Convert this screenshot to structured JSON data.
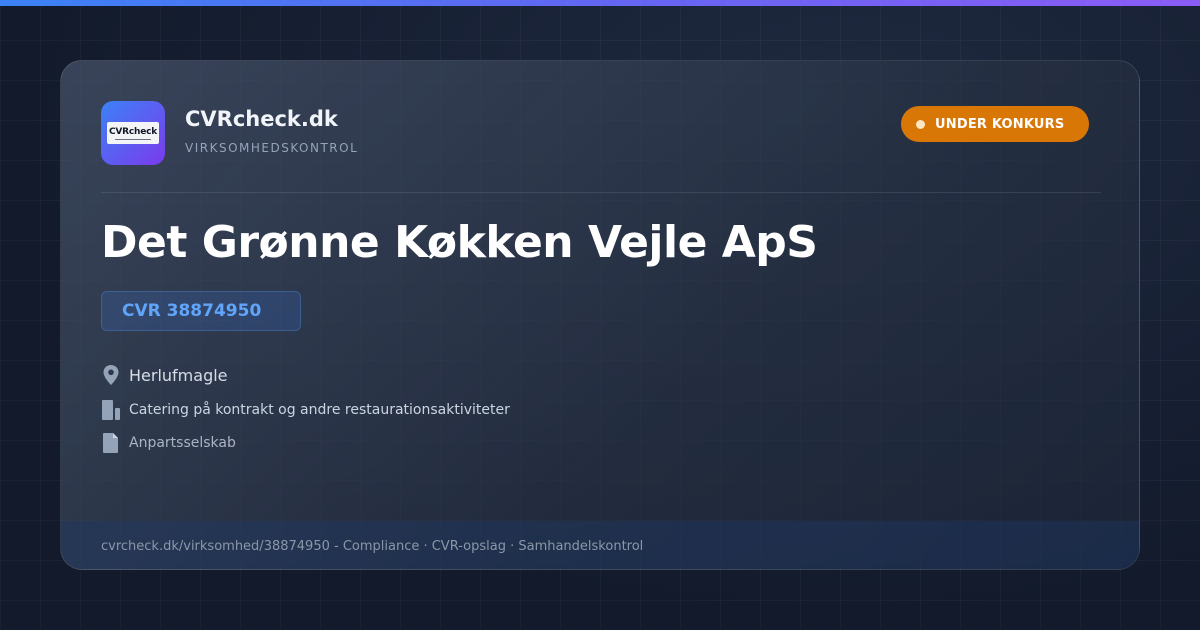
{
  "brand": {
    "logo_text": "CVRcheck",
    "name": "CVRcheck.dk",
    "tagline": "VIRKSOMHEDSKONTROL"
  },
  "status": {
    "label": "UNDER KONKURS",
    "color": "#d97706"
  },
  "company": {
    "name": "Det Grønne Køkken Vejle ApS",
    "cvr": "CVR 38874950",
    "location": "Herlufmagle",
    "industry": "Catering på kontrakt og andre restaurationsaktiviteter",
    "legal_form": "Anpartsselskab"
  },
  "icons": {
    "location": "location-pin-icon",
    "industry": "building-icon",
    "legal_form": "document-icon"
  },
  "footer": {
    "text": "cvrcheck.dk/virksomhed/38874950 - Compliance · CVR-opslag · Samhandelskontrol"
  },
  "colors": {
    "accent": "#60a5fa",
    "brand_gradient_start": "#3b82f6",
    "brand_gradient_end": "#8b5cf6",
    "background": "#121a2b"
  }
}
